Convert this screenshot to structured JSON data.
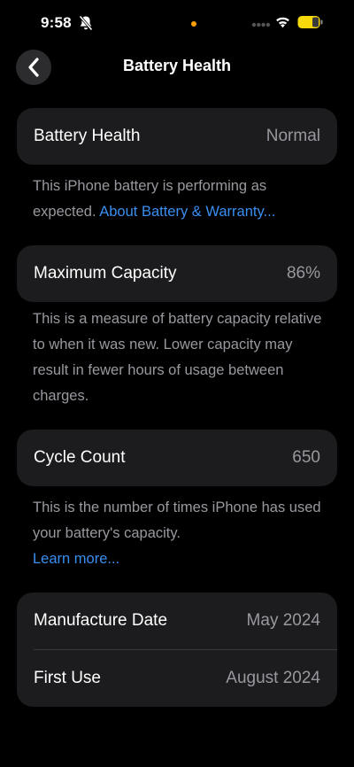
{
  "status_bar": {
    "time": "9:58",
    "icons": [
      "bell-slash-icon",
      "orange-dot-indicator",
      "cellular-dots-icon",
      "wifi-icon",
      "battery-icon"
    ],
    "battery_color": "#f5d90a",
    "indicator_color": "#ff9f0a"
  },
  "nav": {
    "back_icon": "chevron-left-icon",
    "title": "Battery Health"
  },
  "health": {
    "label": "Battery Health",
    "value": "Normal",
    "note": "This iPhone battery is performing as expected.",
    "link": "About Battery & Warranty..."
  },
  "capacity": {
    "label": "Maximum Capacity",
    "value": "86%",
    "note": "This is a measure of battery capacity relative to when it was new. Lower capacity may result in fewer hours of usage between charges."
  },
  "cycles": {
    "label": "Cycle Count",
    "value": "650",
    "note": "This is the number of times iPhone has used your battery's capacity.",
    "link": "Learn more..."
  },
  "dates": {
    "manufacture_label": "Manufacture Date",
    "manufacture_value": "May 2024",
    "first_use_label": "First Use",
    "first_use_value": "August 2024"
  },
  "colors": {
    "background": "#000000",
    "card": "#1c1c1e",
    "secondary_text": "#98989f",
    "link": "#3a8ef0"
  }
}
